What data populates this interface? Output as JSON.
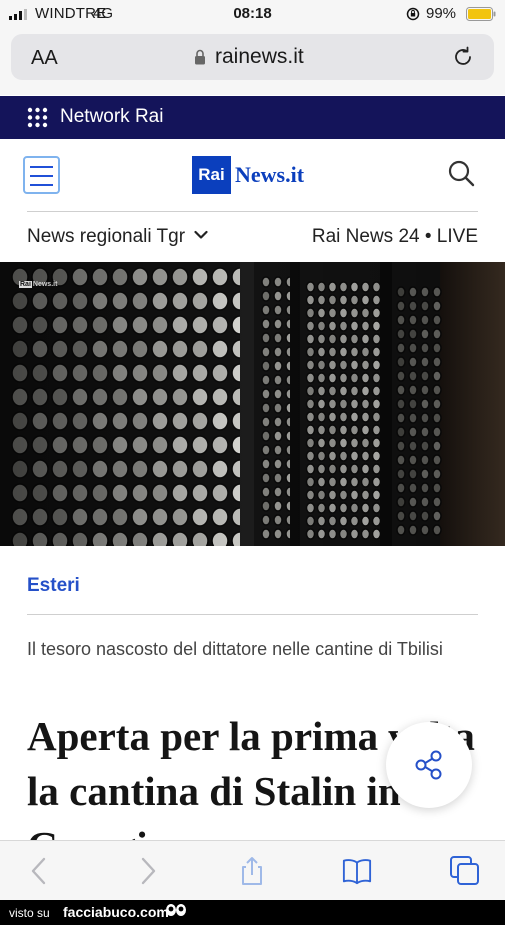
{
  "status_bar": {
    "carrier": "WINDTRE",
    "network": "4G",
    "time": "08:18",
    "battery": "99%"
  },
  "browser": {
    "aa_label": "AA",
    "domain": "rainews.it"
  },
  "network_bar": {
    "label": "Network Rai"
  },
  "site_header": {
    "logo_rai": "Rai",
    "logo_news": "News.it",
    "regionali_label": "News regionali Tgr",
    "live_label": "Rai News 24 • LIVE"
  },
  "hero": {
    "watermark_rai": "Rai",
    "watermark_news": "News.it"
  },
  "article": {
    "category": "Esteri",
    "subtitle": "Il tesoro nascosto del dittatore nelle cantine di Tbilisi",
    "headline": "Aperta per la prima volta la cantina di Stalin in Georgia"
  },
  "colors": {
    "network_bg": "#14145a",
    "brand_blue": "#0b3fbd",
    "category_blue": "#2550c8"
  },
  "icons": [
    "signal-icon",
    "rotation-lock-icon",
    "battery-icon",
    "padlock-icon",
    "reload-icon",
    "grid-icon",
    "hamburger-icon",
    "search-icon",
    "chevron-down-icon",
    "share-icon",
    "back-icon",
    "forward-icon",
    "share-sheet-icon",
    "bookmarks-icon",
    "tabs-icon"
  ],
  "credit": {
    "prefix": "visto su",
    "site": "facciabuco.com"
  }
}
